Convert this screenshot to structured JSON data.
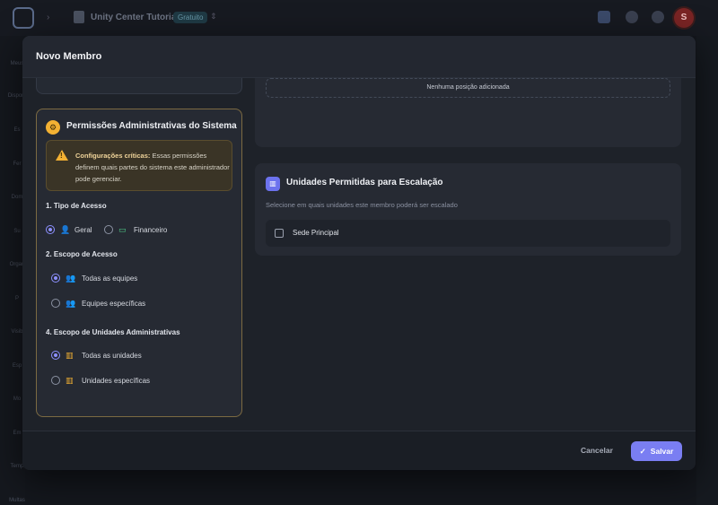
{
  "topbar": {
    "workspace_title": "Unity Center Tutorial",
    "plan_badge": "Gratuito",
    "avatar_initial": "S"
  },
  "sidebar": {
    "items": [
      "Meus",
      "Disponí",
      "Es",
      "Fer",
      "Dom",
      "Su",
      "Organ",
      "P",
      "Visib",
      "Esp",
      "Mo",
      "Em",
      "Temp",
      "Multas"
    ]
  },
  "modal": {
    "title": "Novo Membro",
    "positions": {
      "empty_text": "Nenhuma posição adicionada"
    },
    "permissions": {
      "title": "Permissões Administrativas do Sistema",
      "warning_strong": "Configurações críticas:",
      "warning_text": " Essas permissões definem quais partes do sistema este administrador pode gerenciar.",
      "access_type": {
        "label": "1. Tipo de Acesso",
        "options": [
          {
            "label": "Geral",
            "selected": true,
            "icon": "user-gear-icon"
          },
          {
            "label": "Financeiro",
            "selected": false,
            "icon": "money-icon"
          }
        ]
      },
      "access_scope": {
        "label": "2. Escopo de Acesso",
        "options": [
          {
            "label": "Todas as equipes",
            "selected": true,
            "icon": "team-icon"
          },
          {
            "label": "Equipes específicas",
            "selected": false,
            "icon": "team-specific-icon"
          }
        ]
      },
      "unit_scope": {
        "label": "4. Escopo de Unidades Administrativas",
        "options": [
          {
            "label": "Todas as unidades",
            "selected": true,
            "icon": "building-icon"
          },
          {
            "label": "Unidades específicas",
            "selected": false,
            "icon": "building-icon"
          }
        ]
      }
    },
    "units": {
      "title": "Unidades Permitidas para Escalação",
      "subtitle": "Selecione em quais unidades este membro poderá ser escalado",
      "items": [
        {
          "label": "Sede Principal",
          "checked": false
        }
      ]
    },
    "footer": {
      "cancel_label": "Cancelar",
      "save_label": "Salvar"
    }
  },
  "colors": {
    "accent": "#7a7ef2",
    "warning": "#f3b133",
    "card_border_warning": "#7c6a42"
  }
}
